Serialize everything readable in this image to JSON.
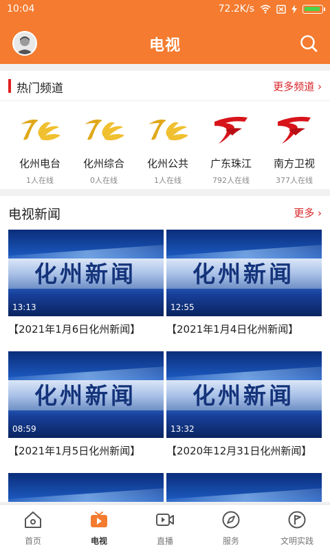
{
  "status_bar": {
    "time": "10:04",
    "network_speed": "72.2K/s"
  },
  "header": {
    "title": "电视"
  },
  "hot_channels": {
    "title": "热门频道",
    "more_label": "更多频道",
    "items": [
      {
        "name": "化州电台",
        "online": "1人在线",
        "logo": "gold-tv-logo-icon"
      },
      {
        "name": "化州综合",
        "online": "0人在线",
        "logo": "gold-tv-logo-icon"
      },
      {
        "name": "化州公共",
        "online": "1人在线",
        "logo": "gold-tv-logo-icon"
      },
      {
        "name": "广东珠江",
        "online": "792人在线",
        "logo": "red-gdtv-logo-icon"
      },
      {
        "name": "南方卫视",
        "online": "377人在线",
        "logo": "red-gdtv-logo-icon"
      }
    ]
  },
  "tv_news": {
    "title": "电视新闻",
    "more_label": "更多",
    "videos": [
      {
        "thumb_text": "化州新闻",
        "duration": "13:13",
        "title": "【2021年1月6日化州新闻】"
      },
      {
        "thumb_text": "化州新闻",
        "duration": "12:55",
        "title": "【2021年1月4日化州新闻】"
      },
      {
        "thumb_text": "化州新闻",
        "duration": "08:59",
        "title": "【2021年1月5日化州新闻】"
      },
      {
        "thumb_text": "化州新闻",
        "duration": "13:32",
        "title": "【2020年12月31日化州新闻】"
      },
      {
        "thumb_text": "",
        "duration": "",
        "title": ""
      },
      {
        "thumb_text": "",
        "duration": "",
        "title": ""
      }
    ]
  },
  "bottom_nav": [
    {
      "label": "首页",
      "icon": "home-icon"
    },
    {
      "label": "电视",
      "icon": "tv-icon",
      "active": true
    },
    {
      "label": "直播",
      "icon": "video-camera-icon"
    },
    {
      "label": "服务",
      "icon": "compass-icon"
    },
    {
      "label": "文明实践",
      "icon": "flag-icon"
    }
  ],
  "colors": {
    "accent": "#f47b2f",
    "highlight": "#d9262b"
  }
}
